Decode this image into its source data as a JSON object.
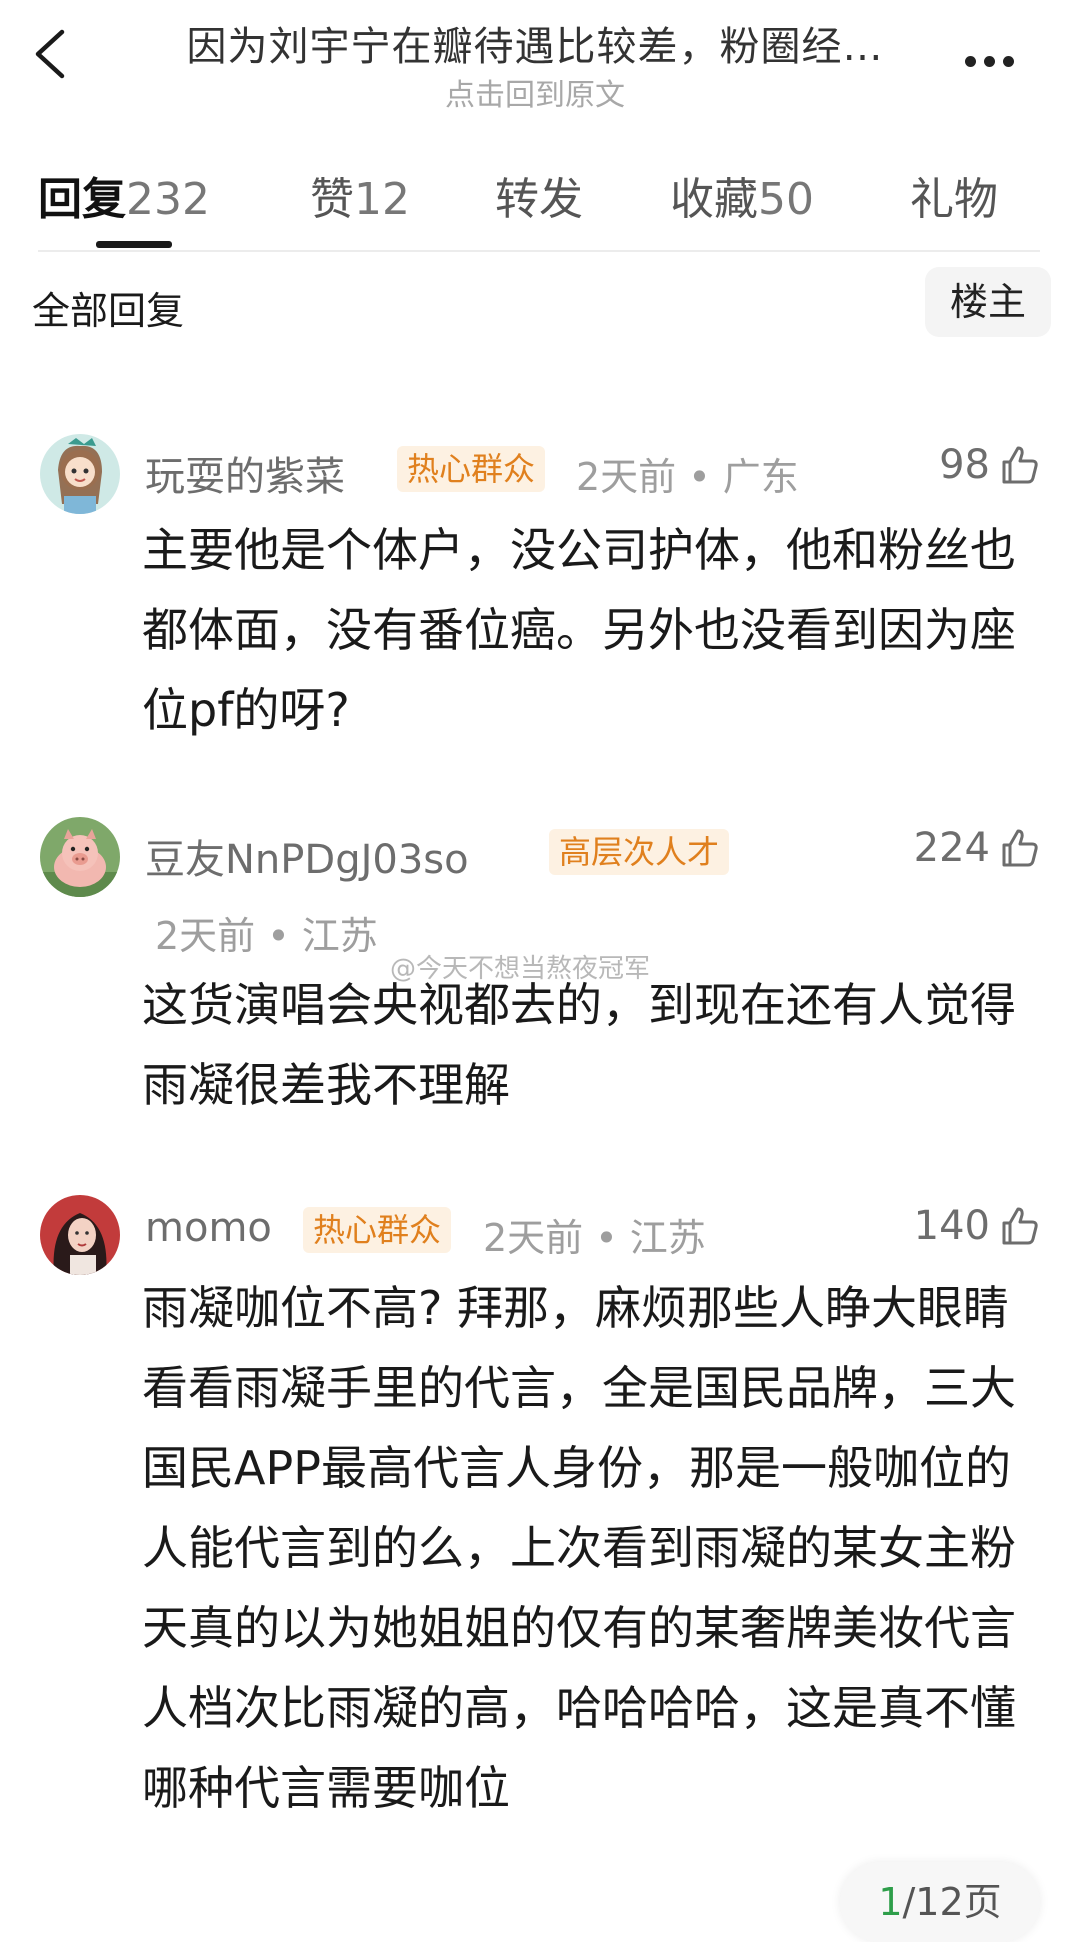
{
  "header": {
    "title": "因为刘宇宁在瓣待遇比较差，粉圈经…",
    "subtitle": "点击回到原文"
  },
  "tabs": [
    {
      "label": "回复",
      "count": "232",
      "active": true
    },
    {
      "label": "赞",
      "count": "12"
    },
    {
      "label": "转发",
      "count": ""
    },
    {
      "label": "收藏",
      "count": "50"
    },
    {
      "label": "礼物",
      "count": ""
    }
  ],
  "filter": {
    "all_label": "全部回复",
    "owner_label": "楼主"
  },
  "comments": [
    {
      "user": "玩耍的紫菜",
      "badge": "热心群众",
      "meta": "2天前 • 广东",
      "likes": "98",
      "text": "主要他是个体户，没公司护体，他和粉丝也都体面，没有番位癌。另外也没看到因为座位pf的呀?"
    },
    {
      "user": "豆友NnPDgJ03so",
      "badge": "高层次人才",
      "meta": "2天前 • 江苏",
      "likes": "224",
      "text": "这货演唱会央视都去的，到现在还有人觉得雨凝很差我不理解"
    },
    {
      "user": "momo",
      "badge": "热心群众",
      "meta": "2天前 • 江苏",
      "likes": "140",
      "text": "雨凝咖位不高? 拜那，麻烦那些人睁大眼睛看看雨凝手里的代言，全是国民品牌，三大国民APP最高代言人身份，那是一般咖位的人能代言到的么，上次看到雨凝的某女主粉天真的以为她姐姐的仅有的某奢牌美妆代言人档次比雨凝的高，哈哈哈哈，这是真不懂哪种代言需要咖位"
    }
  ],
  "watermark": "@今天不想当熬夜冠军",
  "pager": {
    "current": "1",
    "total": "/12页"
  },
  "colors": {
    "badge_text": "#e0801e",
    "badge_bg": "#fdf1e2",
    "pager_current": "#2e9e4a"
  }
}
